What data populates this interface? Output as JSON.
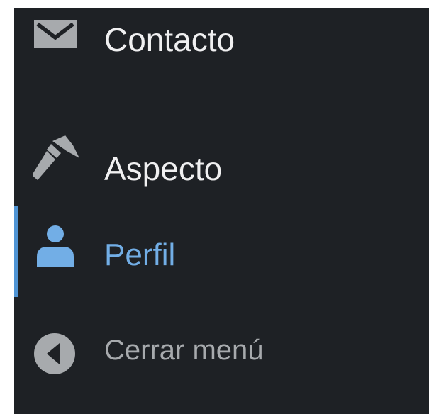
{
  "menu": {
    "items": [
      {
        "label": "Contacto",
        "icon": "envelope-icon"
      },
      {
        "label": "Aspecto",
        "icon": "paintbrush-icon"
      },
      {
        "label": "Perfil",
        "icon": "user-icon",
        "active": true
      },
      {
        "label": "Cerrar menú",
        "icon": "collapse-arrow-icon"
      }
    ]
  },
  "colors": {
    "sidebar_bg": "#1e2125",
    "icon_default": "#a7aaad",
    "text_default": "#f0f0f1",
    "active_text": "#72aee6",
    "active_bar": "#4f94d4",
    "collapse_text": "#a7aaad"
  }
}
